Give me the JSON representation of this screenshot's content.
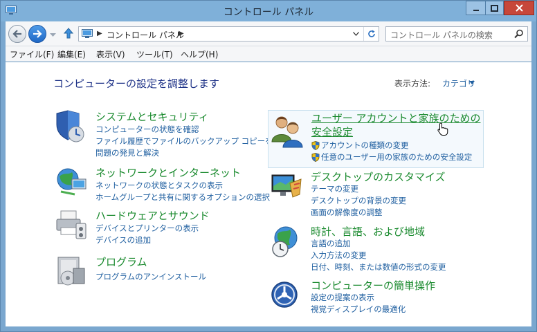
{
  "window": {
    "title": "コントロール パネル"
  },
  "address": {
    "path": "コントロール パネル"
  },
  "search": {
    "placeholder": "コントロール パネルの検索"
  },
  "menu": [
    "ファイル(F)",
    "編集(E)",
    "表示(V)",
    "ツール(T)",
    "ヘルプ(H)"
  ],
  "content": {
    "heading": "コンピューターの設定を調整します",
    "view_label": "表示方法:",
    "view_value": "カテゴリ"
  },
  "categories": {
    "system": {
      "title": "システムとセキュリティ",
      "links": [
        "コンピューターの状態を確認",
        "ファイル履歴でファイルのバックアップ コピーを保存",
        "問題の発見と解決"
      ]
    },
    "network": {
      "title": "ネットワークとインターネット",
      "links": [
        "ネットワークの状態とタスクの表示",
        "ホームグループと共有に関するオプションの選択"
      ]
    },
    "hardware": {
      "title": "ハードウェアとサウンド",
      "links": [
        "デバイスとプリンターの表示",
        "デバイスの追加"
      ]
    },
    "programs": {
      "title": "プログラム",
      "links": [
        "プログラムのアンインストール"
      ]
    },
    "users": {
      "title": "ユーザー アカウントと家族のための安全設定",
      "links": [
        "アカウントの種類の変更",
        "任意のユーザー用の家族のための安全設定"
      ]
    },
    "desktop": {
      "title": "デスクトップのカスタマイズ",
      "links": [
        "テーマの変更",
        "デスクトップの背景の変更",
        "画面の解像度の調整"
      ]
    },
    "clock": {
      "title": "時計、言語、および地域",
      "links": [
        "言語の追加",
        "入力方法の変更",
        "日付、時刻、または数値の形式の変更"
      ]
    },
    "ease": {
      "title": "コンピューターの簡単操作",
      "links": [
        "設定の提案の表示",
        "視覚ディスプレイの最適化"
      ]
    }
  }
}
